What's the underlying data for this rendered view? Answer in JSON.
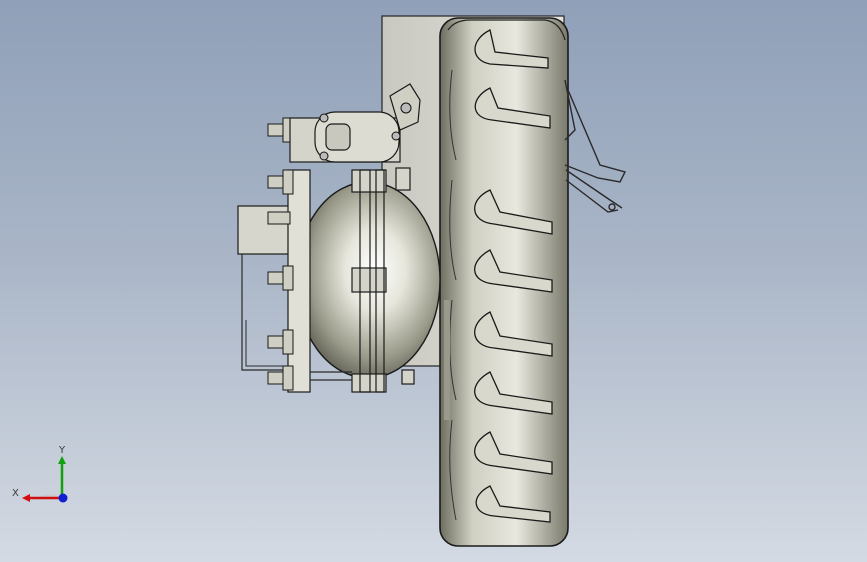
{
  "viewport": {
    "background_top": "#8fa0b8",
    "background_bottom": "#d4dae3"
  },
  "triad": {
    "x_label": "X",
    "y_label": "Y",
    "x_color": "#d01010",
    "y_color": "#10a010",
    "z_color": "#1020d0"
  },
  "model": {
    "tire_color": "#bcbcaa",
    "hub_color": "#d9d9cc",
    "outline_color": "#1a1a1a"
  }
}
